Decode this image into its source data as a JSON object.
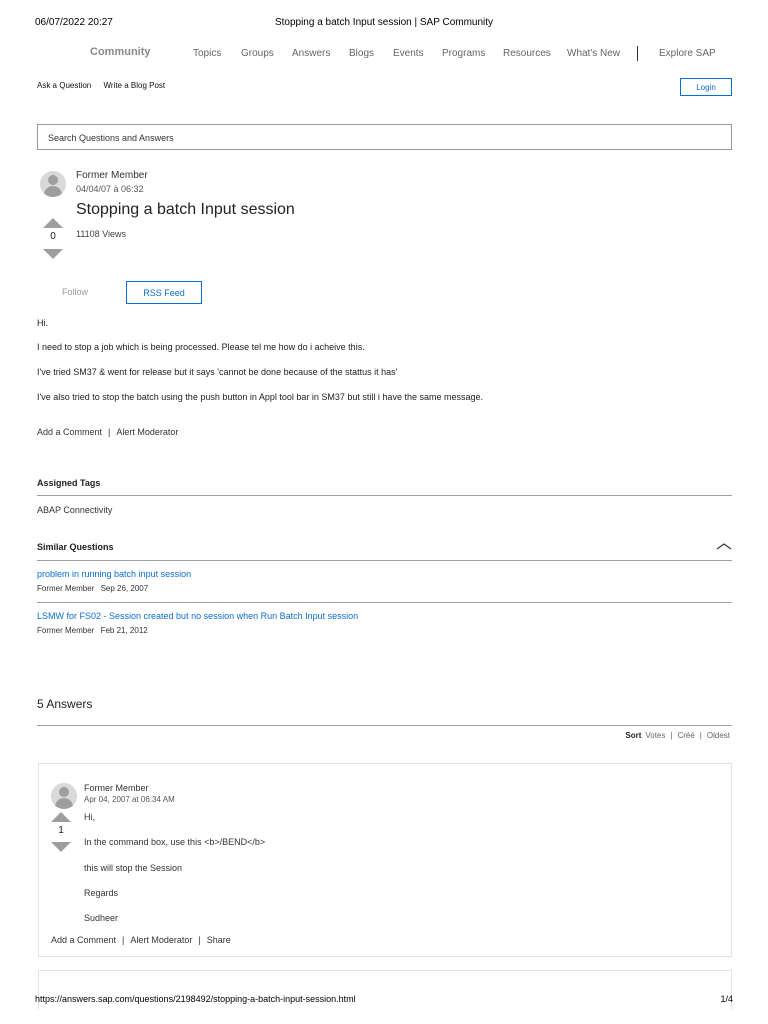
{
  "print_header": {
    "timestamp": "06/07/2022 20:27",
    "title": "Stopping a batch Input session | SAP Community"
  },
  "nav": {
    "brand": "Community",
    "links": [
      "Topics",
      "Groups",
      "Answers",
      "Blogs",
      "Events",
      "Programs",
      "Resources",
      "What's New",
      "Explore SAP"
    ]
  },
  "subnav": {
    "ask": "Ask a Question",
    "write": "Write a Blog Post",
    "login": "Login"
  },
  "search": {
    "placeholder": "Search Questions and Answers"
  },
  "question": {
    "author": "Former Member",
    "date": "04/04/07 à 06:32",
    "title": "Stopping a batch Input session",
    "votes": "0",
    "views": "11108 Views",
    "follow": "Follow",
    "rss": "RSS Feed",
    "body": [
      "Hi.",
      "I need to stop a job which is being processed. Please tel me how do i acheive this.",
      "I've tried SM37 & went for release but it says 'cannot be done because of the stattus it has'",
      "I've also tried to stop the batch using the push button in Appl tool bar in SM37 but still i have the same message."
    ],
    "add_comment": "Add a Comment",
    "alert": "Alert Moderator"
  },
  "tags": {
    "heading": "Assigned Tags",
    "items": [
      "ABAP Connectivity"
    ]
  },
  "similar": {
    "heading": "Similar Questions",
    "items": [
      {
        "title": "problem in running batch input session",
        "author": "Former Member",
        "date": "Sep 26, 2007"
      },
      {
        "title": "LSMW for FS02 - Session created but no session when Run Batch Input session",
        "author": "Former Member",
        "date": "Feb 21, 2012"
      }
    ]
  },
  "answers": {
    "heading": "5 Answers",
    "sort": {
      "label": "Sort",
      "options": [
        "Votes",
        "Créé",
        "Oldest"
      ]
    },
    "items": [
      {
        "author": "Former Member",
        "date": "Apr 04, 2007 at 06:34 AM",
        "votes": "1",
        "lines": [
          "Hi,",
          "In the command box, use this <b>/BEND</b>",
          "this will stop the Session",
          "Regards",
          "Sudheer"
        ],
        "add_comment": "Add a Comment",
        "alert": "Alert Moderator",
        "share": "Share"
      }
    ]
  },
  "print_footer": {
    "url": "https://answers.sap.com/questions/2198492/stopping-a-batch-input-session.html",
    "page": "1/4"
  }
}
